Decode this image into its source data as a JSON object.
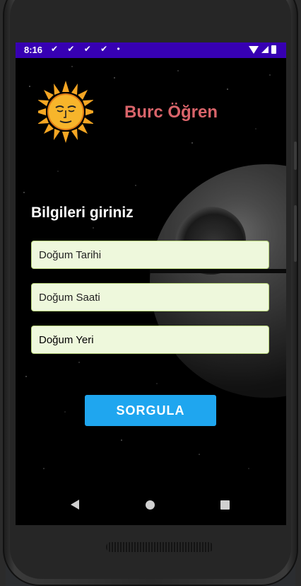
{
  "status_bar": {
    "time": "8:16",
    "icons": "✔ ✔ ✔ ✔ •"
  },
  "app": {
    "title": "Burc Öğren",
    "prompt": "Bilgileri giriniz",
    "fields": [
      {
        "label": "Doğum Tarihi"
      },
      {
        "label": "Doğum Saati"
      },
      {
        "label": "Doğum Yeri"
      }
    ],
    "query_button": "SORGULA"
  },
  "colors": {
    "status_bar": "#3700b3",
    "title": "#d9646a",
    "field_bg": "#eef8dc",
    "button": "#1fa6ef"
  },
  "icons": {
    "logo": "sun-face-icon",
    "nav_back": "back-triangle-icon",
    "nav_home": "home-circle-icon",
    "nav_recent": "recents-square-icon"
  }
}
